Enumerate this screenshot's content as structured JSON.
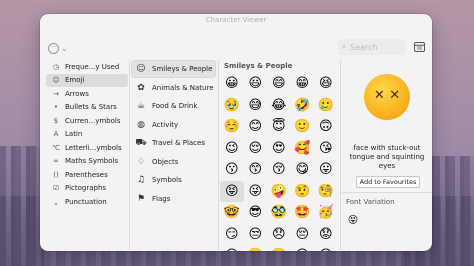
{
  "window": {
    "title": "Character Viewer"
  },
  "toolbar": {
    "more_icon": "ellipsis-circle-icon",
    "search_placeholder": "Search",
    "layout_icon": "sidebar-layout-icon"
  },
  "categories": [
    {
      "label": "Freque...y Used",
      "icon": "clock-icon",
      "glyph": "◷"
    },
    {
      "label": "Emoji",
      "icon": "emoji-face-icon",
      "glyph": "☺",
      "active": true
    },
    {
      "label": "Arrows",
      "icon": "arrow-icon",
      "glyph": "→"
    },
    {
      "label": "Bullets & Stars",
      "icon": "bullet-icon",
      "glyph": "•"
    },
    {
      "label": "Curren...ymbols",
      "icon": "currency-icon",
      "glyph": "$"
    },
    {
      "label": "Latin",
      "icon": "latin-icon",
      "glyph": "A"
    },
    {
      "label": "Letterli...ymbols",
      "icon": "letterlike-icon",
      "glyph": "℃"
    },
    {
      "label": "Maths Symbols",
      "icon": "math-icon",
      "glyph": "∞"
    },
    {
      "label": "Parentheses",
      "icon": "parentheses-icon",
      "glyph": "()"
    },
    {
      "label": "Pictographs",
      "icon": "pictograph-icon",
      "glyph": "☑"
    },
    {
      "label": "Punctuation",
      "icon": "punctuation-icon",
      "glyph": "„"
    }
  ],
  "subcategories": [
    {
      "label": "Smileys & People",
      "icon": "smiley-icon",
      "glyph": "☺",
      "active": true
    },
    {
      "label": "Animals & Nature",
      "icon": "paw-icon",
      "glyph": "✿"
    },
    {
      "label": "Food & Drink",
      "icon": "cup-icon",
      "glyph": "☕"
    },
    {
      "label": "Activity",
      "icon": "ball-icon",
      "glyph": "◍"
    },
    {
      "label": "Travel & Places",
      "icon": "car-icon",
      "glyph": "⛟"
    },
    {
      "label": "Objects",
      "icon": "bulb-icon",
      "glyph": "♢"
    },
    {
      "label": "Symbols",
      "icon": "symbols-icon",
      "glyph": "♫"
    },
    {
      "label": "Flags",
      "icon": "flag-icon",
      "glyph": "⚑"
    }
  ],
  "grid": {
    "title": "Smileys & People",
    "emojis": [
      "😀",
      "😃",
      "😄",
      "😁",
      "😆",
      "🥹",
      "😅",
      "😂",
      "🤣",
      "🥲",
      "☺️",
      "😊",
      "😇",
      "🙂",
      "🙃",
      "😉",
      "😌",
      "😍",
      "🥰",
      "😘",
      "😗",
      "😙",
      "😚",
      "😋",
      "😛",
      "😝",
      "😜",
      "🤪",
      "🤨",
      "🧐",
      "🤓",
      "😎",
      "🥸",
      "🤩",
      "🥳",
      "😏",
      "😒",
      "😞",
      "😔",
      "😟",
      "😕",
      "🙁",
      "☹️",
      "😣",
      "😖"
    ],
    "selected_index": 25
  },
  "detail": {
    "emoji": "😝",
    "name": "face with stuck-out tongue and squinting eyes",
    "add_button": "Add to Favourites",
    "font_variation_title": "Font Variation",
    "font_variation_emoji": "😝"
  }
}
